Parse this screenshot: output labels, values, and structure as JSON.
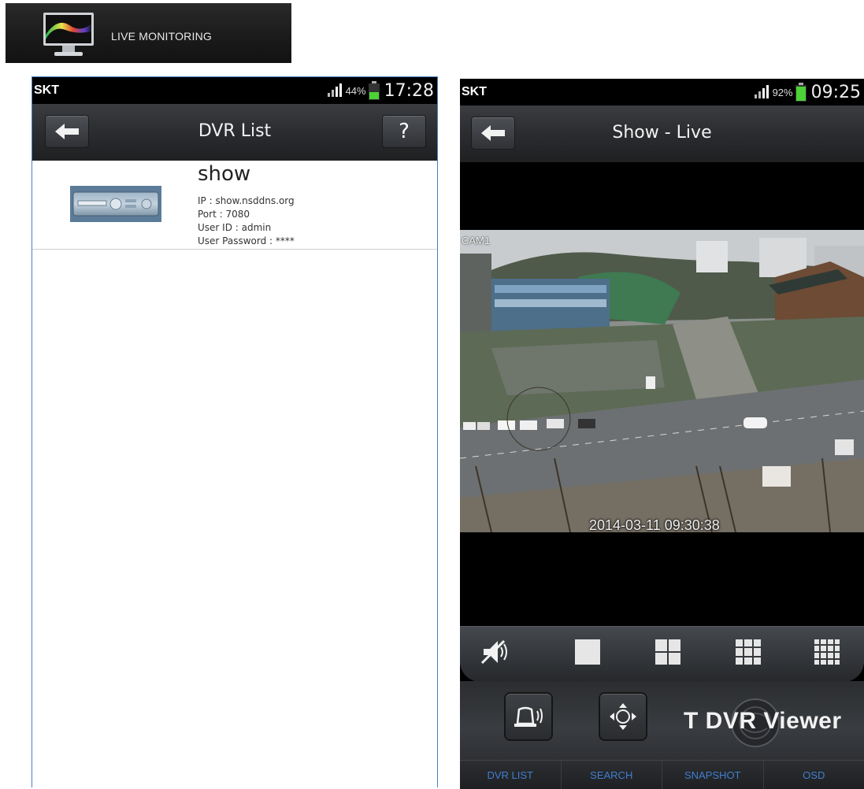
{
  "banner": {
    "title": "LIVE MONITORING",
    "icon": "monitor-icon"
  },
  "phone1": {
    "status": {
      "carrier": "SKT",
      "battery": "44%",
      "time": "17:28"
    },
    "header": {
      "title": "DVR List",
      "help_label": "?"
    },
    "dvr_items": [
      {
        "name": "show",
        "ip": "IP : show.nsddns.org",
        "port": "Port : 7080",
        "user_id": "User ID : admin",
        "user_password": "User Password : ****"
      }
    ]
  },
  "phone2": {
    "status": {
      "carrier": "SKT",
      "battery": "92%",
      "time": "09:25"
    },
    "header": {
      "title": "Show - Live"
    },
    "video": {
      "camera": "CAM1",
      "timestamp": "2014-03-11  09:30:38"
    },
    "layout_buttons": [
      "mute-icon",
      "single-view-icon",
      "quad-view-icon",
      "nine-view-icon",
      "sixteen-view-icon"
    ],
    "controls": {
      "brand": "T DVR Viewer"
    },
    "tabs": [
      "DVR LIST",
      "SEARCH",
      "SNAPSHOT",
      "OSD"
    ]
  },
  "colors": {
    "tab_text": "#3f7fcf",
    "battery_green": "#4cd137",
    "frame_border": "#4a7fc0"
  }
}
